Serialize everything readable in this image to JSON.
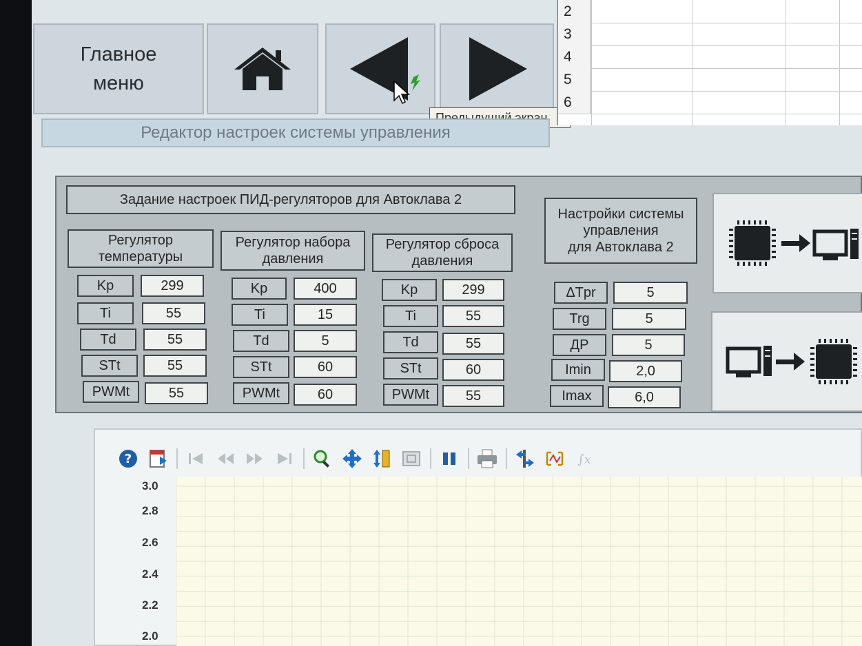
{
  "nav": {
    "main_menu_label": "Главное\nменю",
    "home_icon": "home-icon",
    "prev_icon": "triangle-left-icon",
    "next_icon": "triangle-right-icon",
    "tooltip": "Предыдущий экран"
  },
  "editor_title": "Редактор настроек системы управления",
  "spreadsheet": {
    "row_numbers": [
      "2",
      "3",
      "4",
      "5",
      "6"
    ]
  },
  "pid": {
    "title": "Задание настроек ПИД-регуляторов для Автоклава 2",
    "temperature": {
      "header": "Регулятор\nтемпературы",
      "rows": [
        {
          "label": "Kp",
          "value": "299"
        },
        {
          "label": "Ti",
          "value": "55"
        },
        {
          "label": "Td",
          "value": "55"
        },
        {
          "label": "STt",
          "value": "55"
        },
        {
          "label": "PWMt",
          "value": "55"
        }
      ]
    },
    "pressure_set": {
      "header": "Регулятор набора\nдавления",
      "rows": [
        {
          "label": "Kp",
          "value": "400"
        },
        {
          "label": "Ti",
          "value": "15"
        },
        {
          "label": "Td",
          "value": "5"
        },
        {
          "label": "STt",
          "value": "60"
        },
        {
          "label": "PWMt",
          "value": "60"
        }
      ]
    },
    "pressure_release": {
      "header": "Регулятор сброса\nдавления",
      "rows": [
        {
          "label": "Kp",
          "value": "299"
        },
        {
          "label": "Ti",
          "value": "55"
        },
        {
          "label": "Td",
          "value": "55"
        },
        {
          "label": "STt",
          "value": "60"
        },
        {
          "label": "PWMt",
          "value": "55"
        }
      ]
    }
  },
  "system": {
    "header": "Настройки системы\nуправления\nдля Автоклава 2",
    "rows": [
      {
        "label": "ΔTpr",
        "value": "5"
      },
      {
        "label": "Trg",
        "value": "5"
      },
      {
        "label": "ДP",
        "value": "5"
      },
      {
        "label": "Imin",
        "value": "2,0"
      },
      {
        "label": "Imax",
        "value": "6,0"
      }
    ]
  },
  "transfer": {
    "read_icon": "controller-to-pc-icon",
    "write_icon": "pc-to-controller-icon"
  },
  "chart_toolbar": [
    "help-icon",
    "export-icon",
    "first-icon",
    "rewind-icon",
    "forward-icon",
    "last-icon",
    "zoom-icon",
    "pan-icon",
    "vertical-scale-icon",
    "fit-icon",
    "pause-icon",
    "print-icon",
    "swap-icon",
    "cursor-icon",
    "formula-icon"
  ],
  "chart_data": {
    "type": "line",
    "series": [],
    "ytick_labels": [
      "3.0",
      "2.8",
      "2.6",
      "2.4",
      "2.2",
      "2.0"
    ],
    "ylim": [
      2.0,
      3.0
    ],
    "grid": true
  },
  "colors": {
    "panel_bg": "#b6bec2",
    "value_bg": "#eff1ef",
    "plot_bg": "#fbf9e8",
    "accent_icon": "#1f6fc4"
  }
}
